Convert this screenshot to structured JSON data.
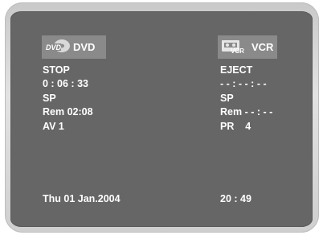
{
  "dvd": {
    "label": "DVD",
    "icon_text": "DVD",
    "status": "STOP",
    "time": "0 : 06 : 33",
    "speed": "SP",
    "remaining": "Rem 02:08",
    "input": "AV 1"
  },
  "vcr": {
    "label": "VCR",
    "icon_text": "VCR",
    "status": "EJECT",
    "time": "- - : - - : - -",
    "speed": "SP",
    "remaining": "Rem - - : - -",
    "program": "PR    4"
  },
  "footer": {
    "date": "Thu 01 Jan.2004",
    "clock": "20 : 49"
  },
  "icons": [
    "dvd-disc-icon",
    "vcr-cassette-icon"
  ],
  "colors": {
    "screen": "#666666",
    "badge": "#8a8a8a",
    "text": "#ffffff",
    "bezel": "#d6d6d6"
  }
}
